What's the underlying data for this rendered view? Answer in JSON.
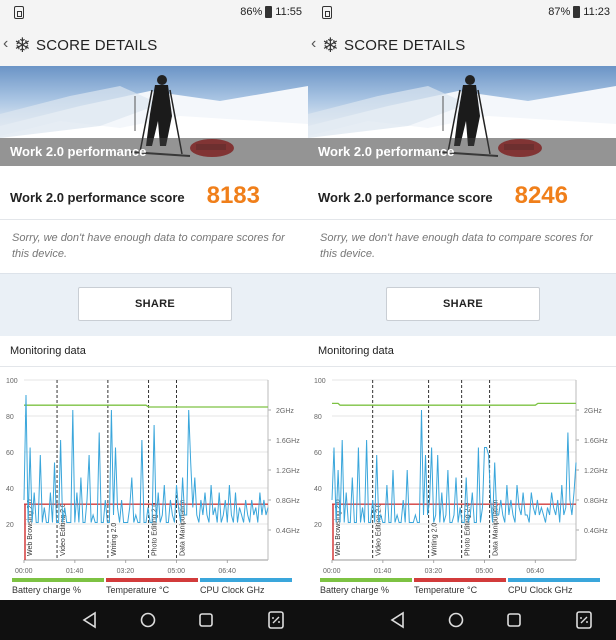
{
  "panels": [
    {
      "status": {
        "battery": "86%",
        "time": "11:55"
      },
      "appbar": {
        "title": "SCORE DETAILS"
      },
      "hero": {
        "banner": "Work 2.0 performance"
      },
      "score": {
        "label": "Work 2.0 performance score",
        "value": "8183",
        "message": "Sorry, we don't have enough data to compare scores for this device."
      },
      "share_label": "SHARE",
      "monitor": {
        "title": "Monitoring data"
      },
      "chart_data": {
        "type": "line",
        "x_ticks": [
          "00:00",
          "01:40",
          "03:20",
          "05:00",
          "06:40"
        ],
        "y_left_ticks": [
          "100",
          "80",
          "60",
          "40",
          "20"
        ],
        "y_right_ticks": [
          "2GHz",
          "1.6GHz",
          "1.2GHz",
          "0.8GHz",
          "0.4GHz"
        ],
        "x_range_seconds": [
          0,
          480
        ],
        "y_left_range": [
          0,
          100
        ],
        "y_right_range": [
          0,
          2.4
        ],
        "segments": [
          {
            "label": "Web Browsing 2.0",
            "start": 0
          },
          {
            "label": "Video Editing 2.0",
            "start": 65
          },
          {
            "label": "Writing 2.0",
            "start": 165
          },
          {
            "label": "Photo Editing 2.0",
            "start": 245
          },
          {
            "label": "Data Manipulation",
            "start": 300
          }
        ],
        "series": [
          {
            "name": "Battery charge %",
            "color": "#7dc243",
            "x": [
              0,
              240,
              245,
              480
            ],
            "y": [
              86,
              86,
              85,
              85
            ]
          },
          {
            "name": "Temperature °C",
            "color": "#d23b3b",
            "x": [
              0,
              480
            ],
            "y": [
              31,
              31
            ]
          },
          {
            "name": "CPU Clock GHz",
            "color": "#3aa6db",
            "x": [
              0,
              4,
              8,
              12,
              16,
              20,
              24,
              28,
              32,
              36,
              40,
              44,
              48,
              52,
              56,
              60,
              64,
              68,
              72,
              76,
              80,
              84,
              88,
              92,
              96,
              100,
              104,
              108,
              112,
              116,
              120,
              124,
              128,
              132,
              136,
              140,
              144,
              148,
              152,
              156,
              160,
              164,
              168,
              172,
              176,
              180,
              184,
              188,
              192,
              196,
              200,
              204,
              208,
              212,
              216,
              220,
              224,
              228,
              232,
              236,
              240,
              244,
              248,
              252,
              256,
              260,
              264,
              268,
              272,
              276,
              280,
              284,
              288,
              292,
              296,
              300,
              304,
              308,
              312,
              316,
              320,
              324,
              328,
              332,
              336,
              340,
              344,
              348,
              352,
              356,
              360,
              364,
              368,
              372,
              376,
              380,
              384,
              388,
              392,
              396,
              400,
              404,
              408,
              412,
              416,
              420,
              424,
              428,
              432,
              436,
              440,
              444,
              448,
              452,
              456,
              460,
              464,
              468,
              472,
              476,
              480
            ],
            "y": [
              0.8,
              2.2,
              0.5,
              1.5,
              0.5,
              0.9,
              0.5,
              0.5,
              1.4,
              0.5,
              0.7,
              0.5,
              0.5,
              0.9,
              0.5,
              1.3,
              0.5,
              0.5,
              1.6,
              0.5,
              0.7,
              0.5,
              0.5,
              0.5,
              2.0,
              0.5,
              0.9,
              0.5,
              1.1,
              0.5,
              0.5,
              0.8,
              1.4,
              0.5,
              0.6,
              0.5,
              0.5,
              1.7,
              0.5,
              0.5,
              0.8,
              0.5,
              0.5,
              2.0,
              0.6,
              1.5,
              0.7,
              0.5,
              0.8,
              0.5,
              0.5,
              0.5,
              0.7,
              1.1,
              0.5,
              0.6,
              0.5,
              0.5,
              1.6,
              0.5,
              0.5,
              0.7,
              0.5,
              0.5,
              1.8,
              0.5,
              0.9,
              0.5,
              0.6,
              1.0,
              0.5,
              0.5,
              0.8,
              0.6,
              0.5,
              1.0,
              0.7,
              0.5,
              1.1,
              0.6,
              0.6,
              2.0,
              1.3,
              0.7,
              1.1,
              0.6,
              0.5,
              0.8,
              0.6,
              0.9,
              0.6,
              0.5,
              1.0,
              0.6,
              0.7,
              0.5,
              0.9,
              0.5,
              0.6,
              0.8,
              0.5,
              1.0,
              0.6,
              0.5,
              0.9,
              0.5,
              0.7,
              0.6,
              0.5,
              0.8,
              0.6,
              0.5,
              0.8,
              0.6,
              0.7,
              0.5,
              0.9,
              0.6,
              0.8,
              0.6,
              0.7
            ]
          }
        ]
      }
    },
    {
      "status": {
        "battery": "87%",
        "time": "11:23"
      },
      "appbar": {
        "title": "SCORE DETAILS"
      },
      "hero": {
        "banner": "Work 2.0 performance"
      },
      "score": {
        "label": "Work 2.0 performance score",
        "value": "8246",
        "message": "Sorry, we don't have enough data to compare scores for this device."
      },
      "share_label": "SHARE",
      "monitor": {
        "title": "Monitoring data"
      },
      "chart_data": {
        "type": "line",
        "x_ticks": [
          "00:00",
          "01:40",
          "03:20",
          "05:00",
          "06:40"
        ],
        "y_left_ticks": [
          "100",
          "80",
          "60",
          "40",
          "20"
        ],
        "y_right_ticks": [
          "2GHz",
          "1.6GHz",
          "1.2GHz",
          "0.8GHz",
          "0.4GHz"
        ],
        "x_range_seconds": [
          0,
          480
        ],
        "y_left_range": [
          0,
          100
        ],
        "y_right_range": [
          0,
          2.4
        ],
        "segments": [
          {
            "label": "Web Browsing 2.0",
            "start": 0
          },
          {
            "label": "Video Editing 2.0",
            "start": 80
          },
          {
            "label": "Writing 2.0",
            "start": 190
          },
          {
            "label": "Photo Editing 2.0",
            "start": 255
          },
          {
            "label": "Data Manipulation",
            "start": 310
          }
        ],
        "series": [
          {
            "name": "Battery charge %",
            "color": "#7dc243",
            "x": [
              0,
              12,
              16,
              400,
              405,
              480
            ],
            "y": [
              87,
              87,
              86,
              86,
              87,
              87
            ]
          },
          {
            "name": "Temperature °C",
            "color": "#d23b3b",
            "x": [
              0,
              480
            ],
            "y": [
              31,
              31
            ]
          },
          {
            "name": "CPU Clock GHz",
            "color": "#3aa6db",
            "x": [
              0,
              4,
              8,
              12,
              16,
              20,
              24,
              28,
              32,
              36,
              40,
              44,
              48,
              52,
              56,
              60,
              64,
              68,
              72,
              76,
              80,
              84,
              88,
              92,
              96,
              100,
              104,
              108,
              112,
              116,
              120,
              124,
              128,
              132,
              136,
              140,
              144,
              148,
              152,
              156,
              160,
              164,
              168,
              172,
              176,
              180,
              184,
              188,
              192,
              196,
              200,
              204,
              208,
              212,
              216,
              220,
              224,
              228,
              232,
              236,
              240,
              244,
              248,
              252,
              256,
              260,
              264,
              268,
              272,
              276,
              280,
              284,
              288,
              292,
              296,
              300,
              304,
              308,
              312,
              316,
              320,
              324,
              328,
              332,
              336,
              340,
              344,
              348,
              352,
              356,
              360,
              364,
              368,
              372,
              376,
              380,
              384,
              388,
              392,
              396,
              400,
              404,
              408,
              412,
              416,
              420,
              424,
              428,
              432,
              436,
              440,
              444,
              448,
              452,
              456,
              460,
              464,
              468,
              472,
              476,
              480
            ],
            "y": [
              0.8,
              1.5,
              0.5,
              1.2,
              0.5,
              1.6,
              0.5,
              0.9,
              0.5,
              0.5,
              1.1,
              0.5,
              0.5,
              1.5,
              0.5,
              0.7,
              0.5,
              1.6,
              0.5,
              0.5,
              0.8,
              0.5,
              1.4,
              0.5,
              0.6,
              0.5,
              0.5,
              1.0,
              0.5,
              0.5,
              1.2,
              0.5,
              0.6,
              0.5,
              0.5,
              0.8,
              0.5,
              1.2,
              0.5,
              0.5,
              0.5,
              0.6,
              0.5,
              0.5,
              2.0,
              0.6,
              1.4,
              0.6,
              0.8,
              1.5,
              0.5,
              0.6,
              1.4,
              0.5,
              0.9,
              0.5,
              0.6,
              1.2,
              0.5,
              0.5,
              0.6,
              1.1,
              0.5,
              0.7,
              0.5,
              0.5,
              1.1,
              0.5,
              0.6,
              0.9,
              0.5,
              0.5,
              1.5,
              0.5,
              0.7,
              1.5,
              1.5,
              1.4,
              0.8,
              0.5,
              1.3,
              0.6,
              0.6,
              0.8,
              0.6,
              0.5,
              1.0,
              0.6,
              0.8,
              0.6,
              0.5,
              1.0,
              0.7,
              0.6,
              0.9,
              0.6,
              0.6,
              0.5,
              0.9,
              0.7,
              0.6,
              0.8,
              0.6,
              0.7,
              0.6,
              0.5,
              0.7,
              0.6,
              0.9,
              0.7,
              0.6,
              0.8,
              0.5,
              1.0,
              0.6,
              0.7,
              1.7,
              0.8,
              0.6,
              0.9,
              1.3
            ]
          }
        ]
      }
    }
  ],
  "legend": {
    "battery": "Battery charge %",
    "temperature": "Temperature °C",
    "cpu": "CPU Clock GHz"
  },
  "colors": {
    "score": "#f07f1a",
    "battery": "#7dc243",
    "temperature": "#d23b3b",
    "cpu": "#3aa6db"
  },
  "icons": {
    "back": "chevron-left-icon",
    "logo": "snowflake-icon",
    "nav": [
      "back-triangle-icon",
      "home-circle-icon",
      "recents-square-icon",
      "screenshot-icon"
    ]
  }
}
